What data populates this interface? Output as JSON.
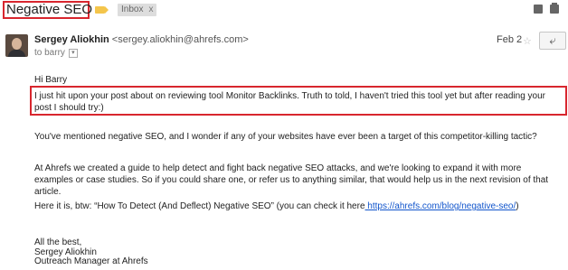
{
  "header": {
    "subject": "Negative SEO",
    "label_chip": "Inbox",
    "label_chip_close": "x"
  },
  "message": {
    "sender_name": "Sergey Aliokhin",
    "sender_email": "<sergey.aliokhin@ahrefs.com>",
    "to_line": "to barry",
    "date": "Feb 2",
    "greeting": "Hi Barry",
    "intro": "I just hit upon your post about on reviewing tool Monitor Backlinks. Truth to told, I haven't tried this tool yet but after reading your post I should try:)",
    "paragraph2": "You've mentioned negative SEO, and I wonder if any of your websites have ever been a target of this competitor-killing tactic?",
    "paragraph3": "At Ahrefs we created a guide to help detect and fight back negative SEO attacks, and we're looking to expand it with more examples or case studies. So if you could share one, or refer us to anything similar, that would help us in the next revision of that article.",
    "paragraph4_text": "Here it is, btw: “How To Detect (And Deflect) Negative SEO” (you can check it here",
    "paragraph4_link": " https://ahrefs.com/blog/negative-seo/",
    "paragraph4_end": ")",
    "signoff": "All the best,",
    "sig_name": "Sergey Aliokhin",
    "sig_title": "Outreach Manager at Ahrefs"
  },
  "icons": {
    "label": "label-tag-icon",
    "print": "print-icon",
    "newwindow": "new-window-icon",
    "reply": "reply-arrow-icon"
  },
  "colors": {
    "highlight_border": "#d8262e",
    "link": "#1155cc",
    "label_tag": "#f4c54b"
  }
}
